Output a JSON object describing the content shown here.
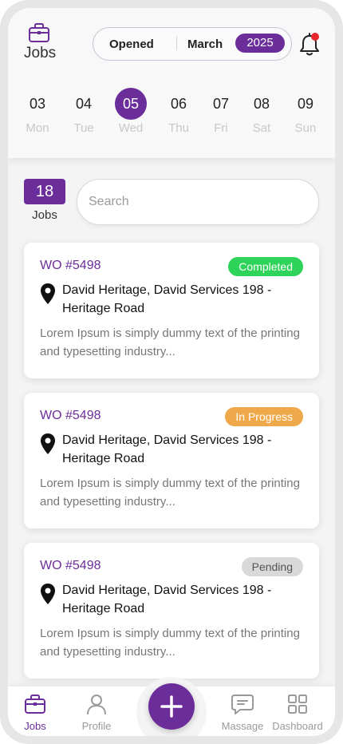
{
  "header": {
    "title": "Jobs",
    "filter": {
      "status": "Opened",
      "month": "March",
      "year": "2025"
    },
    "notification_dot": true
  },
  "calendar": {
    "days": [
      {
        "num": "03",
        "name": "Mon",
        "selected": false
      },
      {
        "num": "04",
        "name": "Tue",
        "selected": false
      },
      {
        "num": "05",
        "name": "Wed",
        "selected": true
      },
      {
        "num": "06",
        "name": "Thu",
        "selected": false
      },
      {
        "num": "07",
        "name": "Fri",
        "selected": false
      },
      {
        "num": "08",
        "name": "Sat",
        "selected": false
      },
      {
        "num": "09",
        "name": "Sun",
        "selected": false
      }
    ]
  },
  "summary": {
    "count": "18",
    "label": "Jobs"
  },
  "search": {
    "placeholder": "Search",
    "value": ""
  },
  "jobs": [
    {
      "wo": "WO #5498",
      "status": "Completed",
      "status_color": "#2ed35a",
      "address": "David Heritage, David Services 198 - Heritage Road",
      "description": "Lorem Ipsum is simply dummy text of the printing and typesetting industry..."
    },
    {
      "wo": "WO #5498",
      "status": "In Progress",
      "status_color": "#f0a94a",
      "address": "David Heritage, David Services 198 - Heritage Road",
      "description": "Lorem Ipsum is simply dummy text of the printing and typesetting industry..."
    },
    {
      "wo": "WO #5498",
      "status": "Pending",
      "status_color": "#d9d9d9",
      "address": "David Heritage, David Services 198 - Heritage Road",
      "description": "Lorem Ipsum is simply dummy text of the printing and typesetting industry..."
    }
  ],
  "nav": {
    "items": [
      {
        "label": "Jobs",
        "icon": "briefcase-icon",
        "active": true
      },
      {
        "label": "Profile",
        "icon": "user-icon",
        "active": false
      },
      {
        "label": "Massage",
        "icon": "chat-icon",
        "active": false
      },
      {
        "label": "Dashboard",
        "icon": "grid-icon",
        "active": false
      }
    ],
    "fab_icon": "plus-icon"
  },
  "colors": {
    "accent": "#6b2d9a",
    "completed": "#2ed35a",
    "in_progress": "#f0a94a",
    "pending": "#d9d9d9",
    "notification": "#e8262d"
  }
}
